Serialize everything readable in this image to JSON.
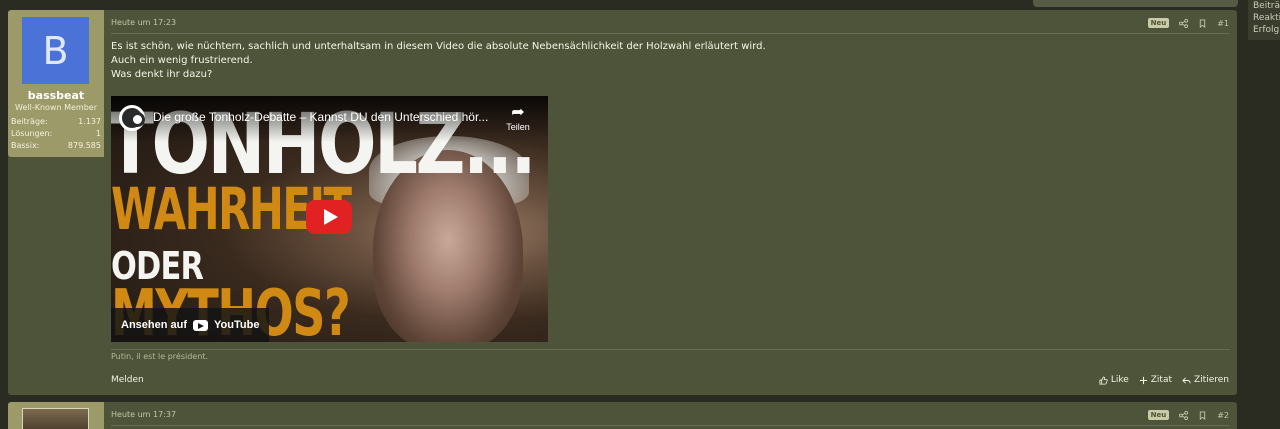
{
  "sidebar_stats": [
    "Beiträ",
    "Reakti",
    "Erfolg"
  ],
  "posts": [
    {
      "user": {
        "avatar_letter": "B",
        "name": "bassbeat",
        "title": "Well-Known Member",
        "stats": [
          {
            "label": "Beiträge:",
            "value": "1.137"
          },
          {
            "label": "Lösungen:",
            "value": "1"
          },
          {
            "label": "Bassix:",
            "value": "879.585"
          }
        ]
      },
      "date": "Heute um 17:23",
      "badge": "Neu",
      "number": "#1",
      "message": [
        "Es ist schön, wie nüchtern, sachlich und unterhaltsam in diesem Video die absolute Nebensächlichkeit der Holzwahl erläutert wird.",
        "Auch ein wenig frustrierend.",
        "Was denkt ihr dazu?"
      ],
      "video": {
        "title": "Die große Tonholz-Debatte – Kannst DU den Unterschied hör...",
        "share_label": "Teilen",
        "watch_label": "Ansehen auf",
        "youtube_label": "YouTube",
        "thumb_line1": "TONHOLZ...",
        "thumb_line2": "WAHRHEIT",
        "thumb_line3": "ODER",
        "thumb_line4": "MYTHOS?"
      },
      "signature": "Putin, il est le président.",
      "report_label": "Melden",
      "actions": {
        "like": "Like",
        "quote": "Zitat",
        "reply": "Zitieren"
      }
    },
    {
      "date": "Heute um 17:37",
      "badge": "Neu",
      "number": "#2"
    }
  ]
}
